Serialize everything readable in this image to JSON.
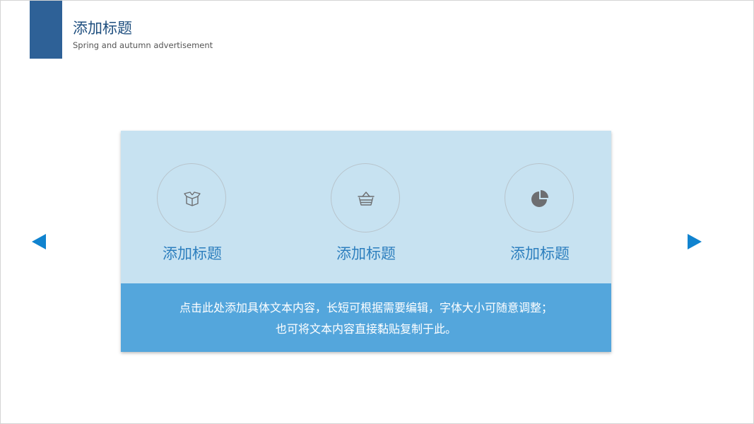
{
  "header": {
    "title": "添加标题",
    "subtitle": "Spring and autumn advertisement",
    "bar_color": "#2e6197"
  },
  "features": [
    {
      "label": "添加标题",
      "icon": "open-box-icon"
    },
    {
      "label": "添加标题",
      "icon": "basket-icon"
    },
    {
      "label": "添加标题",
      "icon": "pie-chart-icon"
    }
  ],
  "content": {
    "line1": "点击此处添加具体文本内容，长短可根据需要编辑，字体大小可随意调整；",
    "line2": "也可将文本内容直接黏贴复制于此。"
  },
  "navigation": {
    "prev_icon": "triangle-left-icon",
    "next_icon": "triangle-right-icon",
    "color": "#1083cf"
  },
  "colors": {
    "card_top": "#c7e2f1",
    "card_bottom": "#54a6dc",
    "feature_label": "#2d7fbe",
    "icon": "#6d6e71"
  }
}
